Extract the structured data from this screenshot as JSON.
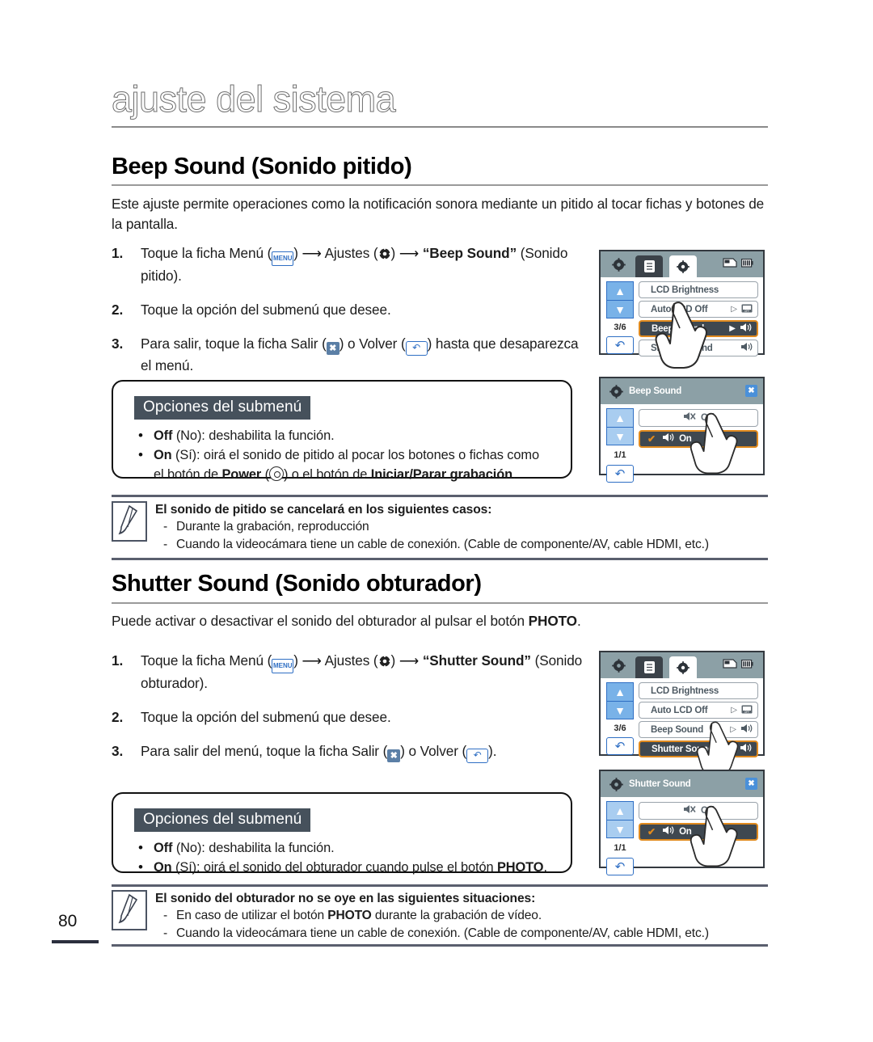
{
  "chapter": {
    "title": "ajuste del sistema"
  },
  "page_number": "80",
  "sections": [
    {
      "heading": "Beep Sound (Sonido pitido)",
      "intro": "Este ajuste permite operaciones como la notificación sonora mediante un pitido al tocar fichas y botones de la pantalla.",
      "steps": [
        {
          "num": "1.",
          "pre": "Toque la ficha Menú (",
          "mid": ") ",
          "ajustes": "Ajustes (",
          "post": ") ",
          "quoted": "“Beep Sound”",
          "tail": " (Sonido pitido)."
        },
        {
          "num": "2.",
          "text": "Toque la opción del submenú que desee."
        },
        {
          "num": "3.",
          "pre": "Para salir, toque la ficha Salir (",
          "mid": ") o Volver (",
          "tail": ") hasta que desaparezca el menú."
        }
      ],
      "options_box": {
        "title": "Opciones del submenú",
        "items": [
          {
            "bold": "Off",
            "rest": " (No): deshabilita la función."
          },
          {
            "bold": "On",
            "rest": " (Sí): oirá el sonido de pitido al pocar los botones o fichas como"
          }
        ],
        "continuation_pre": "el botón de ",
        "continuation_b1": "Power",
        "continuation_mid": " (",
        "continuation_mid2": ") o el botón de ",
        "continuation_b2": "Iniciar/Parar grabación",
        "continuation_end": "."
      },
      "note": {
        "title": "El sonido de pitido se cancelará en los siguientes casos:",
        "items": [
          "Durante la grabación, reproducción",
          "Cuando la videocámara tiene un cable de conexión. (Cable de componente/AV, cable HDMI, etc.)"
        ]
      }
    },
    {
      "heading": "Shutter Sound (Sonido obturador)",
      "intro_pre": "Puede activar o desactivar el sonido del obturador al pulsar el botón ",
      "intro_bold": "PHOTO",
      "intro_end": ".",
      "steps": [
        {
          "num": "1.",
          "pre": "Toque la ficha Menú (",
          "mid": ") ",
          "ajustes": "Ajustes (",
          "post": ") ",
          "quoted": "“Shutter Sound”",
          "tail": " (Sonido obturador)."
        },
        {
          "num": "2.",
          "text": "Toque la opción del submenú que desee."
        },
        {
          "num": "3.",
          "pre": "Para salir del menú, toque la ficha Salir (",
          "mid": ") o Volver (",
          "tail": ")."
        }
      ],
      "options_box": {
        "title": "Opciones del submenú",
        "items": [
          {
            "bold": "Off",
            "rest": " (No): deshabilita la función."
          },
          {
            "bold": "On",
            "rest": " (Sí): oirá el sonido del obturador cuando pulse el botón "
          }
        ],
        "item2_bold_tail": "PHOTO",
        "item2_end": "."
      },
      "note": {
        "title": "El sonido del obturador no se oye en las siguientes situaciones:",
        "items_pre": "En caso de utilizar el botón ",
        "items_bold": "PHOTO",
        "items_post": " durante la grabación de vídeo.",
        "item2": "Cuando la videocámara tiene un cable de conexión. (Cable de componente/AV, cable HDMI, etc.)"
      }
    }
  ],
  "lcd_screens": [
    {
      "id": "beep-menu",
      "type": "menu",
      "tabs": [
        "gear-icon",
        "list-icon",
        "gear-icon"
      ],
      "status_icons": [
        "card-icon",
        "battery-icon"
      ],
      "page_indicator": "3/6",
      "nav_up": "▲",
      "nav_down": "▼",
      "back": "↶",
      "rows": [
        {
          "label": "LCD Brightness",
          "selected": false,
          "arrow": "",
          "right_icon": ""
        },
        {
          "label": "Auto LCD Off",
          "selected": false,
          "arrow": "▷",
          "right_icon": "lcd-off-icon"
        },
        {
          "label": "Beep Sound",
          "selected": true,
          "arrow": "▶",
          "right_icon": "speaker-icon"
        },
        {
          "label": "Shutter Sound",
          "selected": false,
          "arrow": "",
          "right_icon": "speaker-icon"
        }
      ]
    },
    {
      "id": "beep-submenu",
      "type": "submenu",
      "title": "Beep Sound",
      "close": "✖",
      "page_indicator": "1/1",
      "nav_up": "▲",
      "nav_down": "▼",
      "back": "↶",
      "rows": [
        {
          "label": "Off",
          "selected": false,
          "icon": "speaker-mute-icon",
          "check": ""
        },
        {
          "label": "On",
          "selected": true,
          "icon": "speaker-icon",
          "check": "✔"
        }
      ]
    },
    {
      "id": "shutter-menu",
      "type": "menu",
      "tabs": [
        "gear-icon",
        "list-icon",
        "gear-icon"
      ],
      "status_icons": [
        "card-icon",
        "battery-icon"
      ],
      "page_indicator": "3/6",
      "nav_up": "▲",
      "nav_down": "▼",
      "back": "↶",
      "rows": [
        {
          "label": "LCD Brightness",
          "selected": false,
          "arrow": "",
          "right_icon": ""
        },
        {
          "label": "Auto LCD Off",
          "selected": false,
          "arrow": "▷",
          "right_icon": "lcd-off-icon"
        },
        {
          "label": "Beep Sound",
          "selected": false,
          "arrow": "▷",
          "right_icon": "speaker-icon"
        },
        {
          "label": "Shutter Sound",
          "selected": true,
          "arrow": "▶",
          "right_icon": "speaker-icon"
        }
      ]
    },
    {
      "id": "shutter-submenu",
      "type": "submenu",
      "title": "Shutter Sound",
      "close": "✖",
      "page_indicator": "1/1",
      "nav_up": "▲",
      "nav_down": "▼",
      "back": "↶",
      "rows": [
        {
          "label": "Off",
          "selected": false,
          "icon": "speaker-mute-icon",
          "check": ""
        },
        {
          "label": "On",
          "selected": true,
          "icon": "speaker-icon",
          "check": "✔"
        }
      ]
    }
  ],
  "colors": {
    "accent_orange": "#e08a1e",
    "lcd_header": "#8ca0a6",
    "selected_row": "#3f4850",
    "nav_blue": "#79b2e8",
    "badge_dark": "#46515c"
  }
}
